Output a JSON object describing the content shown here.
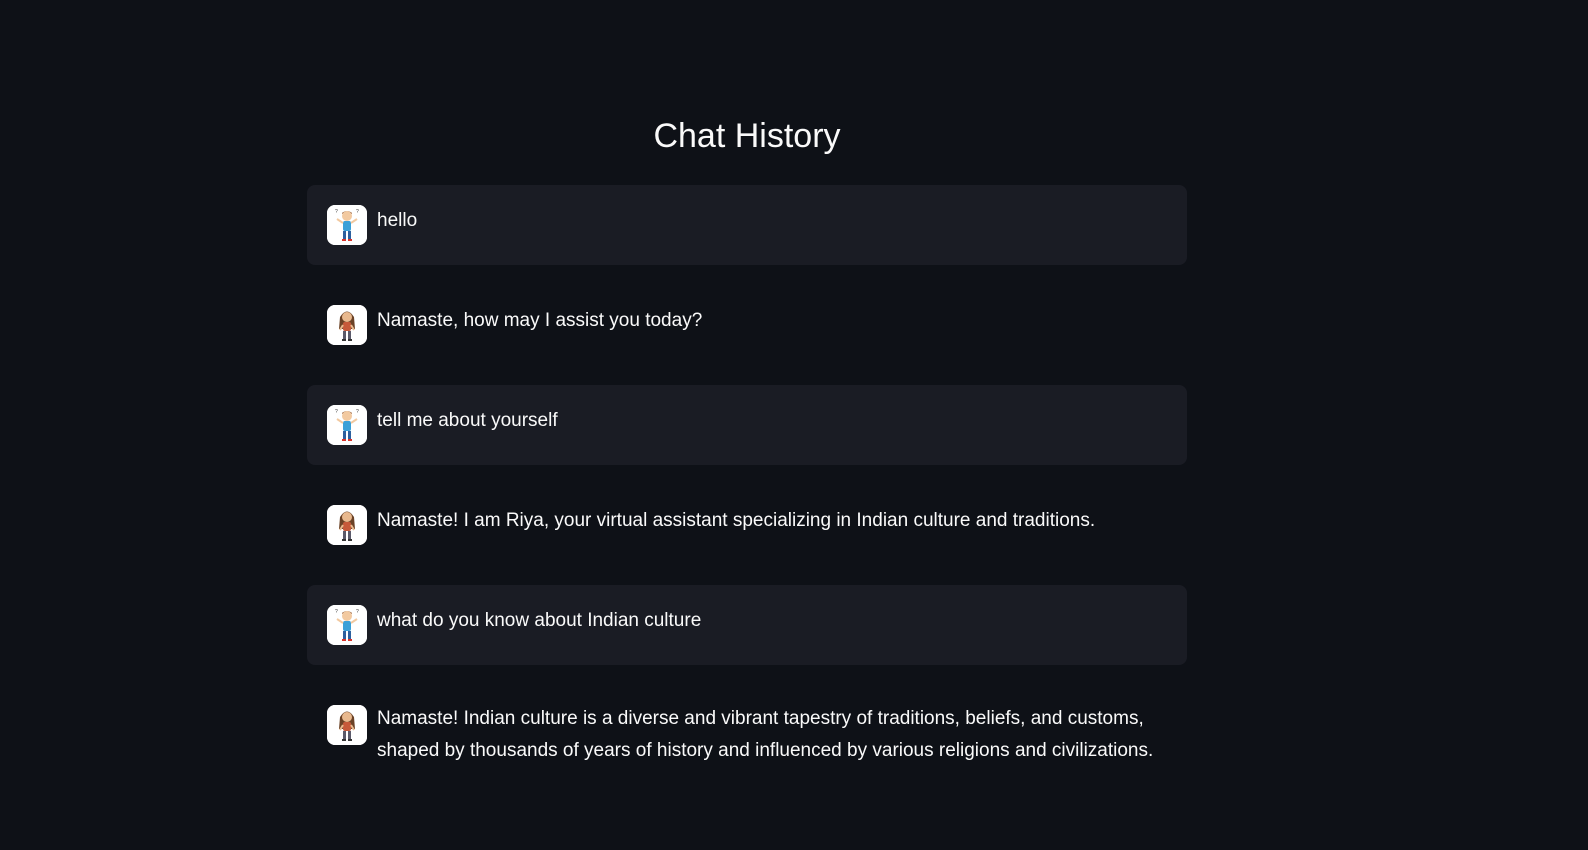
{
  "page": {
    "title": "Chat History"
  },
  "messages": [
    {
      "role": "user",
      "avatar": "user-avatar-icon",
      "text": "hello"
    },
    {
      "role": "assistant",
      "avatar": "assistant-avatar-icon",
      "text": "Namaste, how may I assist you today?"
    },
    {
      "role": "user",
      "avatar": "user-avatar-icon",
      "text": "tell me about yourself"
    },
    {
      "role": "assistant",
      "avatar": "assistant-avatar-icon",
      "text": "Namaste! I am Riya, your virtual assistant specializing in Indian culture and traditions."
    },
    {
      "role": "user",
      "avatar": "user-avatar-icon",
      "text": "what do you know about Indian culture"
    },
    {
      "role": "assistant",
      "avatar": "assistant-avatar-icon",
      "text": "Namaste! Indian culture is a diverse and vibrant tapestry of traditions, beliefs, and customs, shaped by thousands of years of history and influenced by various religions and civilizations."
    }
  ],
  "colors": {
    "background": "#0e1117",
    "user_bubble": "#1a1c24",
    "text": "#fafafa"
  }
}
